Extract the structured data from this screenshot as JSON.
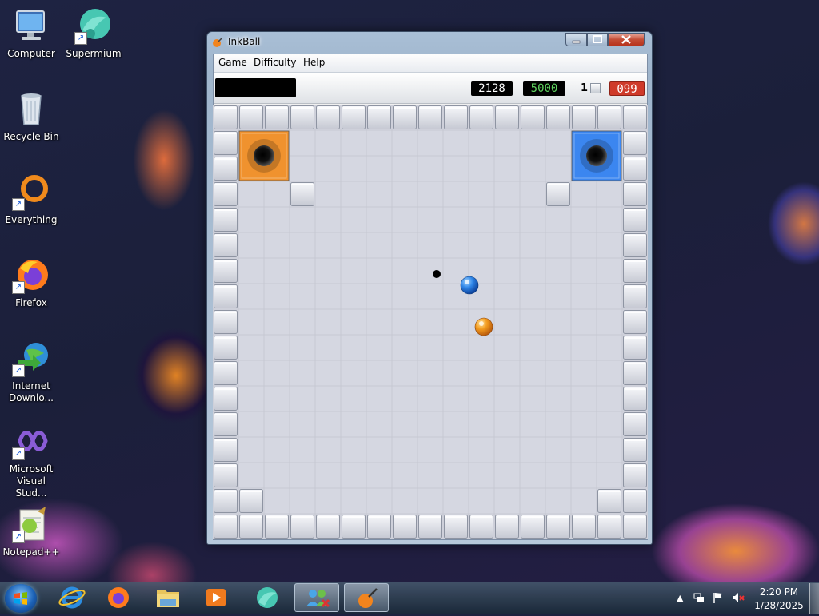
{
  "desktop": {
    "icons": [
      {
        "label": "Computer",
        "icon": "computer-icon"
      },
      {
        "label": "Supermium",
        "icon": "supermium-icon"
      },
      {
        "label": "Recycle Bin",
        "icon": "recycle-bin-icon"
      },
      {
        "label": "Everything",
        "icon": "everything-icon"
      },
      {
        "label": "Firefox",
        "icon": "firefox-icon"
      },
      {
        "label": "Internet\nDownlo...",
        "icon": "internet-download-manager-icon"
      },
      {
        "label": "Microsoft\nVisual Stud...",
        "icon": "visual-studio-icon"
      },
      {
        "label": "Notepad++",
        "icon": "notepad-plus-plus-icon"
      }
    ]
  },
  "window": {
    "title": "InkBall",
    "controls": {
      "minimize": "minimize",
      "maximize": "maximize",
      "close": "close"
    },
    "menu": [
      "Game",
      "Difficulty",
      "Help"
    ],
    "scoreboard": {
      "message": "",
      "current_score": "2128",
      "target_score": "5000",
      "level": "1",
      "time": "099"
    },
    "board": {
      "grid": "17x17",
      "goals": [
        {
          "color": "orange",
          "corner": "top-left"
        },
        {
          "color": "blue",
          "corner": "top-right"
        }
      ],
      "balls": [
        {
          "color": "blue"
        },
        {
          "color": "orange"
        }
      ],
      "ink_dot": "black"
    }
  },
  "taskbar": {
    "pinned": [
      "start-button",
      "internet-explorer-icon",
      "firefox-icon",
      "file-explorer-icon",
      "media-player-icon",
      "supermium-icon",
      "windows-live-messenger-icon",
      "inkball-icon"
    ],
    "tray": [
      "show-hidden-icons",
      "network-icon",
      "action-center-flag-icon",
      "volume-muted-icon"
    ],
    "time": "2:20 PM",
    "date": "1/28/2025"
  },
  "colors": {
    "goal_orange": "#f0922e",
    "goal_blue": "#3b86f0",
    "time_red": "#cf3a2a",
    "target_green": "#5fd35f",
    "tile": "#d9dbe4"
  }
}
